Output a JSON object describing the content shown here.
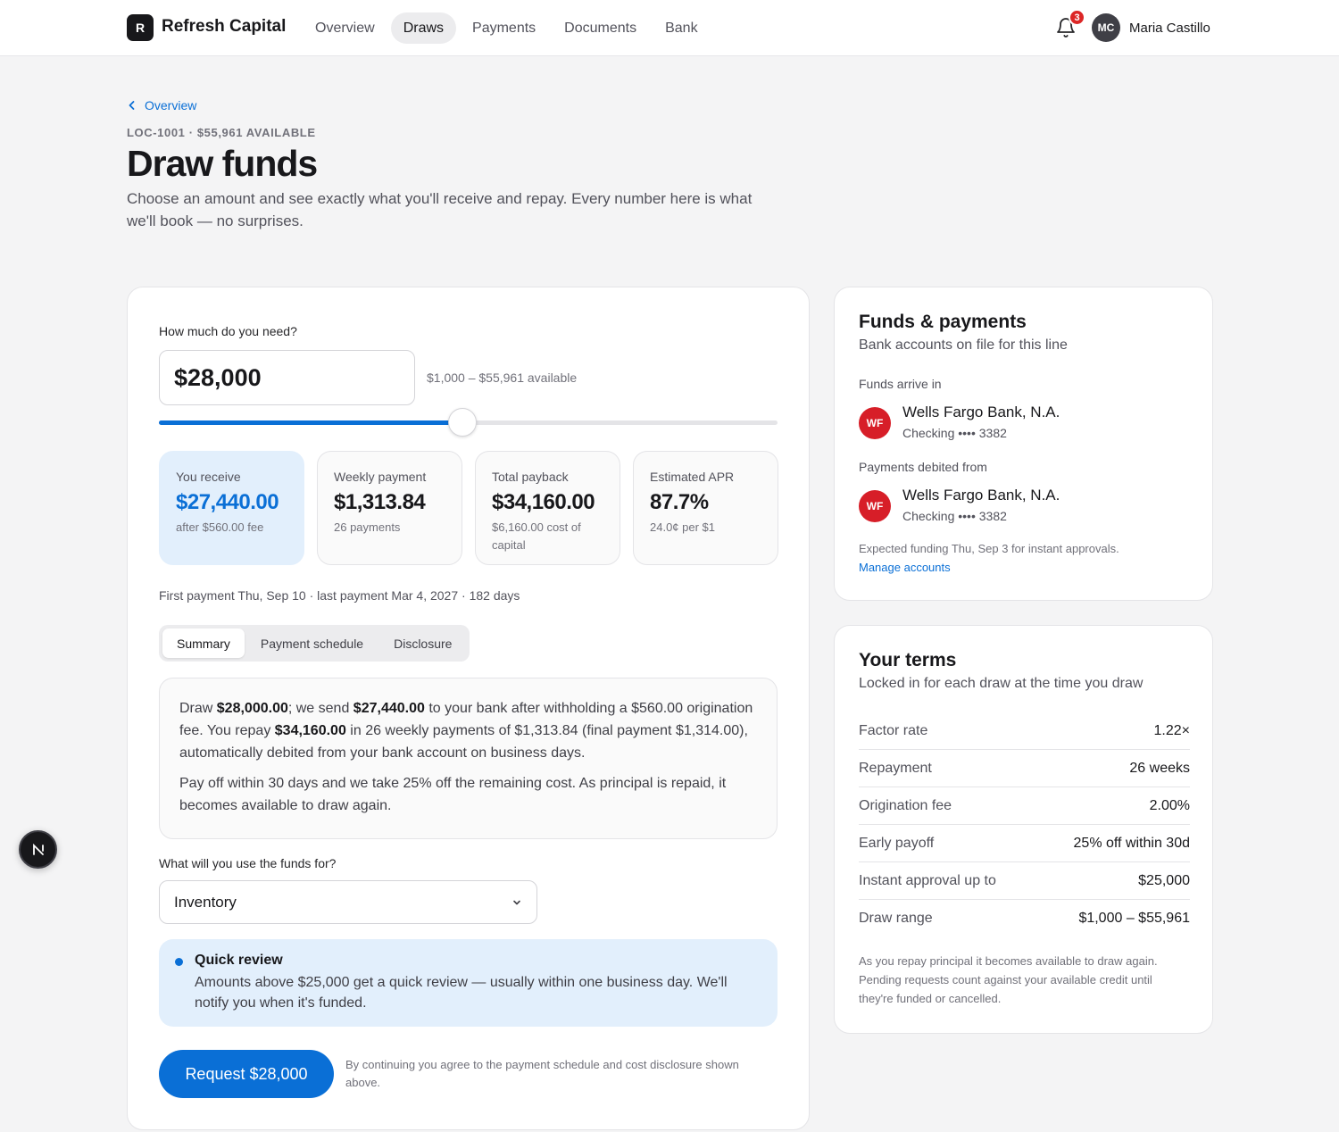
{
  "brand": {
    "logo_letter": "R",
    "name": "Refresh Capital"
  },
  "nav": {
    "tabs": [
      {
        "label": "Overview",
        "active": false
      },
      {
        "label": "Draws",
        "active": true
      },
      {
        "label": "Payments",
        "active": false
      },
      {
        "label": "Documents",
        "active": false
      },
      {
        "label": "Bank",
        "active": false
      }
    ],
    "notifications_count": "3",
    "user": {
      "initials": "MC",
      "name": "Maria Castillo"
    }
  },
  "header": {
    "back_label": "Overview",
    "eyebrow": "LOC-1001 · $55,961 AVAILABLE",
    "title": "Draw funds",
    "subtitle": "Choose an amount and see exactly what you'll receive and repay. Every number here is what we'll book — no surprises."
  },
  "draw": {
    "amount_label": "How much do you need?",
    "amount_value": "$28,000",
    "range_hint": "$1,000 – $55,961 available",
    "slider": {
      "min": 1000,
      "max": 55961,
      "value": 28000
    },
    "stats": [
      {
        "label": "You receive",
        "value": "$27,440.00",
        "sub": "after $560.00 fee",
        "highlight": true
      },
      {
        "label": "Weekly payment",
        "value": "$1,313.84",
        "sub": "26 payments",
        "highlight": false
      },
      {
        "label": "Total payback",
        "value": "$34,160.00",
        "sub": "$6,160.00 cost of capital",
        "highlight": false
      },
      {
        "label": "Estimated APR",
        "value": "87.7%",
        "sub": "24.0¢ per $1",
        "highlight": false
      }
    ],
    "dates_line": "First payment Thu, Sep 10 · last payment Mar 4, 2027 · 182 days",
    "segments": [
      {
        "label": "Summary",
        "active": true
      },
      {
        "label": "Payment schedule",
        "active": false
      },
      {
        "label": "Disclosure",
        "active": false
      }
    ],
    "summary": {
      "p1_a": "Draw ",
      "p1_b": "$28,000.00",
      "p1_c": "; we send ",
      "p1_d": "$27,440.00",
      "p1_e": " to your bank after withholding a $560.00 origination fee. You repay ",
      "p1_f": "$34,160.00",
      "p1_g": " in 26 weekly payments of $1,313.84 (final payment $1,314.00), automatically debited from your bank account on business days.",
      "p2": "Pay off within 30 days and we take 25% off the remaining cost. As principal is repaid, it becomes available to draw again."
    },
    "purpose_label": "What will you use the funds for?",
    "purpose_value": "Inventory",
    "notice": {
      "title": "Quick review",
      "body": "Amounts above $25,000 get a quick review — usually within one business day. We'll notify you when it's funded."
    },
    "request_label": "Request $28,000",
    "disclaimer": "By continuing you agree to the payment schedule and cost disclosure shown above."
  },
  "funds": {
    "title": "Funds & payments",
    "subtitle": "Bank accounts on file for this line",
    "arrive_label": "Funds arrive in",
    "arrive_bank": {
      "logo": "WF",
      "name": "Wells Fargo Bank, N.A.",
      "account": "Checking •••• 3382"
    },
    "debit_label": "Payments debited from",
    "debit_bank": {
      "logo": "WF",
      "name": "Wells Fargo Bank, N.A.",
      "account": "Checking •••• 3382"
    },
    "note": "Expected funding Thu, Sep 3 for instant approvals.",
    "manage_link": "Manage accounts"
  },
  "terms": {
    "title": "Your terms",
    "subtitle": "Locked in for each draw at the time you draw",
    "rows": [
      {
        "key": "Factor rate",
        "value": "1.22×"
      },
      {
        "key": "Repayment",
        "value": "26 weeks"
      },
      {
        "key": "Origination fee",
        "value": "2.00%"
      },
      {
        "key": "Early payoff",
        "value": "25% off within 30d"
      },
      {
        "key": "Instant approval up to",
        "value": "$25,000"
      },
      {
        "key": "Draw range",
        "value": "$1,000 – $55,961"
      }
    ],
    "note": "As you repay principal it becomes available to draw again. Pending requests count against your available credit until they're funded or cancelled."
  },
  "floating_button": {
    "letter": "N"
  },
  "colors": {
    "accent": "#0a6fd6",
    "accent_soft": "#e2effc",
    "bank_logo": "#d71e28",
    "badge": "#dc2626"
  },
  "icons": {
    "back": "chevron-left-icon",
    "bell": "bell-icon",
    "select": "chevron-down-icon"
  }
}
